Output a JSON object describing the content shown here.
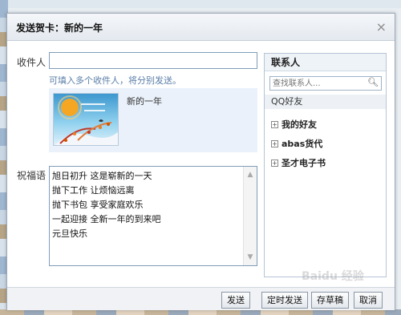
{
  "dialog": {
    "title": "发送贺卡：新的一年",
    "close_glyph": "×"
  },
  "recipient": {
    "label": "收件人",
    "value": "",
    "hint": "可填入多个收件人，将分别发送。"
  },
  "card": {
    "title": "新的一年",
    "image_icon": "greeting-card-image"
  },
  "message": {
    "label": "祝福语",
    "lines": [
      "旭日初升 这是崭新的一天",
      "抛下工作 让烦恼远离",
      "抛下书包 享受家庭欢乐",
      "一起迎接 全新一年的到来吧",
      "元旦快乐"
    ]
  },
  "contacts": {
    "header": "联系人",
    "search_placeholder": "查找联系人...",
    "group_label": "QQ好友",
    "expand_glyph": "+",
    "groups": [
      "我的好友",
      "abas货代",
      "圣才电子书"
    ]
  },
  "footer": {
    "send": "发送",
    "scheduled_send": "定时发送",
    "save_draft": "存草稿",
    "cancel": "取消"
  },
  "watermark": "Baidu 经验",
  "colors": {
    "link_hint": "#5a7ea8",
    "card_bg": "#eaf1fa",
    "border_blue": "#7f9db9"
  }
}
